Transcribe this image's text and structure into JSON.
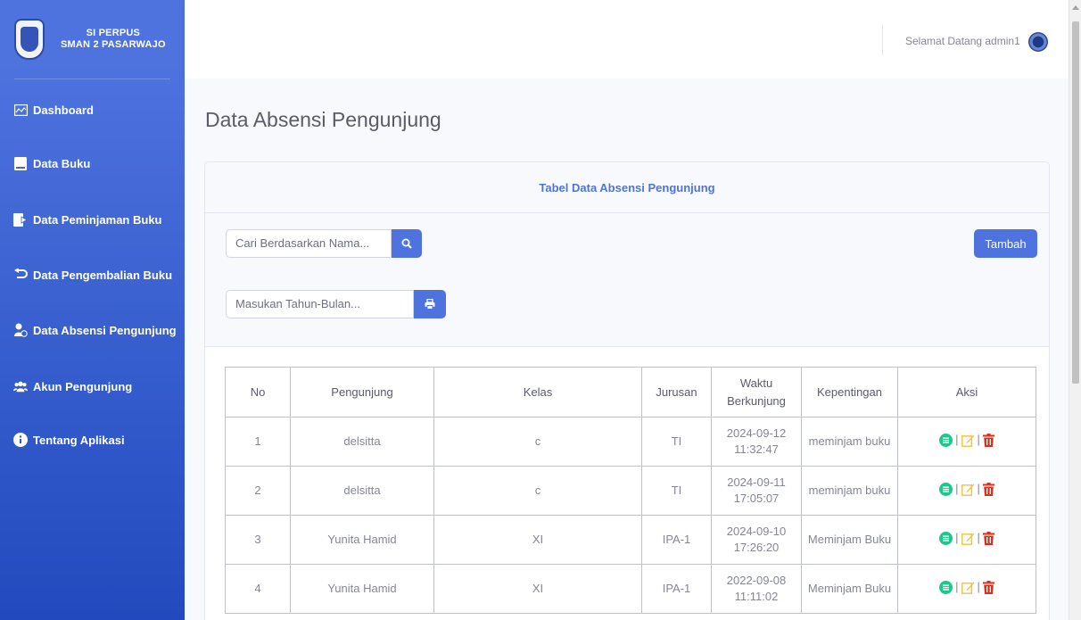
{
  "sidebar": {
    "brand_line1": "SI PERPUS",
    "brand_line2": "SMAN 2 PASARWAJO",
    "items": [
      {
        "label": "Dashboard",
        "icon": "chart-area-icon"
      },
      {
        "label": "Data Buku",
        "icon": "book-icon"
      },
      {
        "label": "Data Peminjaman Buku",
        "icon": "sign-in-icon"
      },
      {
        "label": "Data Pengembalian Buku",
        "icon": "undo-icon"
      },
      {
        "label": "Data Absensi Pengunjung",
        "icon": "user-clock-icon"
      },
      {
        "label": "Akun Pengunjung",
        "icon": "users-icon"
      },
      {
        "label": "Tentang Aplikasi",
        "icon": "info-circle-icon"
      }
    ]
  },
  "topbar": {
    "welcome": "Selamat Datang admin1"
  },
  "page": {
    "title": "Data Absensi Pengunjung"
  },
  "card": {
    "header": "Tabel Data Absensi Pengunjung",
    "search_placeholder": "Cari Berdasarkan Nama...",
    "month_placeholder": "Masukan Tahun-Bulan...",
    "add_label": "Tambah"
  },
  "table": {
    "columns": [
      "No",
      "Pengunjung",
      "Kelas",
      "Jurusan",
      "Waktu",
      "Berkunjung",
      "Kepentingan",
      "Aksi"
    ],
    "rows": [
      {
        "no": "1",
        "pengunjung": "delsitta",
        "kelas": "c",
        "jurusan": "TI",
        "tanggal": "2024-09-12",
        "jam": "11:32:47",
        "kepentingan": "meminjam buku"
      },
      {
        "no": "2",
        "pengunjung": "delsitta",
        "kelas": "c",
        "jurusan": "TI",
        "tanggal": "2024-09-11",
        "jam": "17:05:07",
        "kepentingan": "meminjam buku"
      },
      {
        "no": "3",
        "pengunjung": "Yunita Hamid",
        "kelas": "XI",
        "jurusan": "IPA-1",
        "tanggal": "2024-09-10",
        "jam": "17:26:20",
        "kepentingan": "Meminjam Buku"
      },
      {
        "no": "4",
        "pengunjung": "Yunita Hamid",
        "kelas": "XI",
        "jurusan": "IPA-1",
        "tanggal": "2022-09-08",
        "jam": "11:11:02",
        "kepentingan": "Meminjam Buku"
      }
    ]
  },
  "colors": {
    "primary": "#4e73df",
    "detail": "#1cc88a",
    "edit": "#f6c23e",
    "delete": "#e74a3b"
  }
}
